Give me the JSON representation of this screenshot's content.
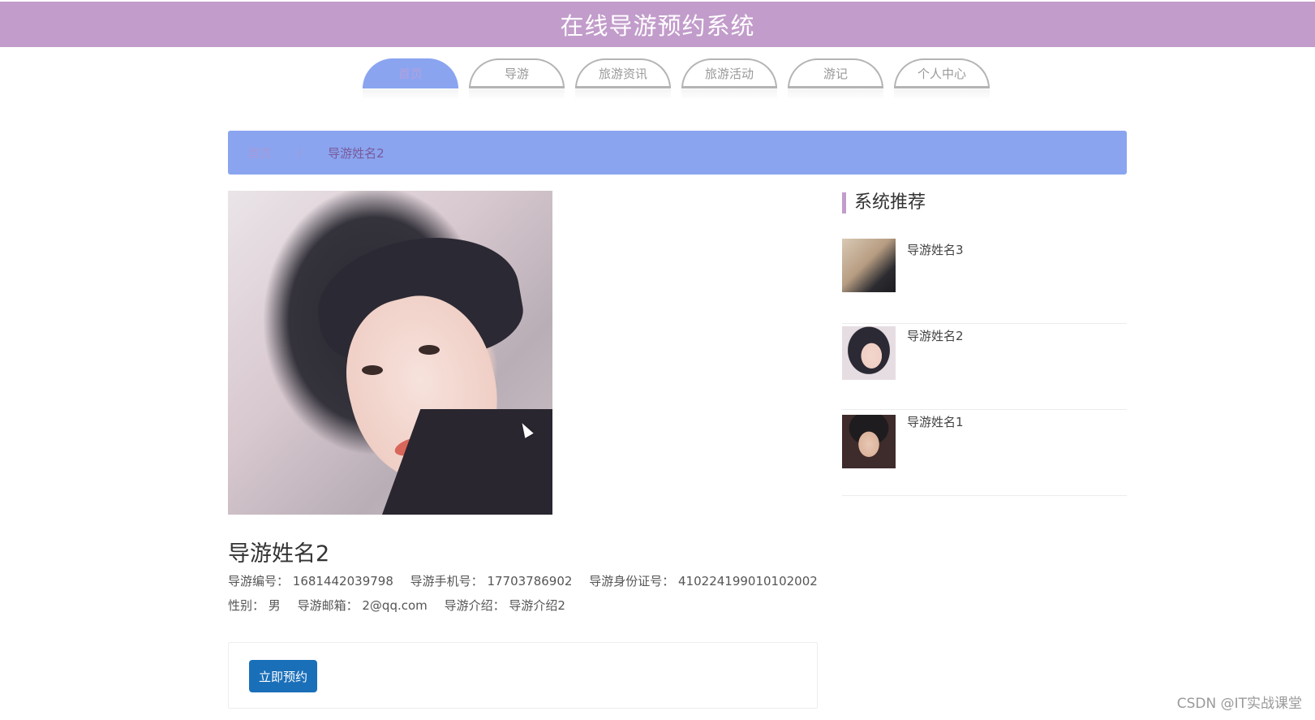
{
  "header": {
    "title": "在线导游预约系统"
  },
  "nav": {
    "tabs": [
      {
        "label": "首页"
      },
      {
        "label": "导游"
      },
      {
        "label": "旅游资讯"
      },
      {
        "label": "旅游活动"
      },
      {
        "label": "游记"
      },
      {
        "label": "个人中心"
      }
    ]
  },
  "breadcrumb": {
    "home": "首页",
    "separator": "/",
    "current": "导游姓名2"
  },
  "guide": {
    "name": "导游姓名2",
    "number_label": "导游编号：",
    "number": "1681442039798",
    "phone_label": "导游手机号：",
    "phone": "17703786902",
    "id_label": "导游身份证号：",
    "id_card": "410224199010102002",
    "gender_label": "性别：",
    "gender": "男",
    "email_label": "导游邮箱：",
    "email": "2@qq.com",
    "intro_label": "导游介绍：",
    "intro": "导游介绍2"
  },
  "actions": {
    "book_label": "立即预约"
  },
  "sidebar": {
    "title": "系统推荐",
    "items": [
      {
        "name": "导游姓名3"
      },
      {
        "name": "导游姓名2"
      },
      {
        "name": "导游姓名1"
      }
    ]
  },
  "watermark": "CSDN @IT实战课堂",
  "colors": {
    "header": "#c29ccb",
    "breadcrumb": "#8aa4f0",
    "button": "#1a6fb9"
  }
}
